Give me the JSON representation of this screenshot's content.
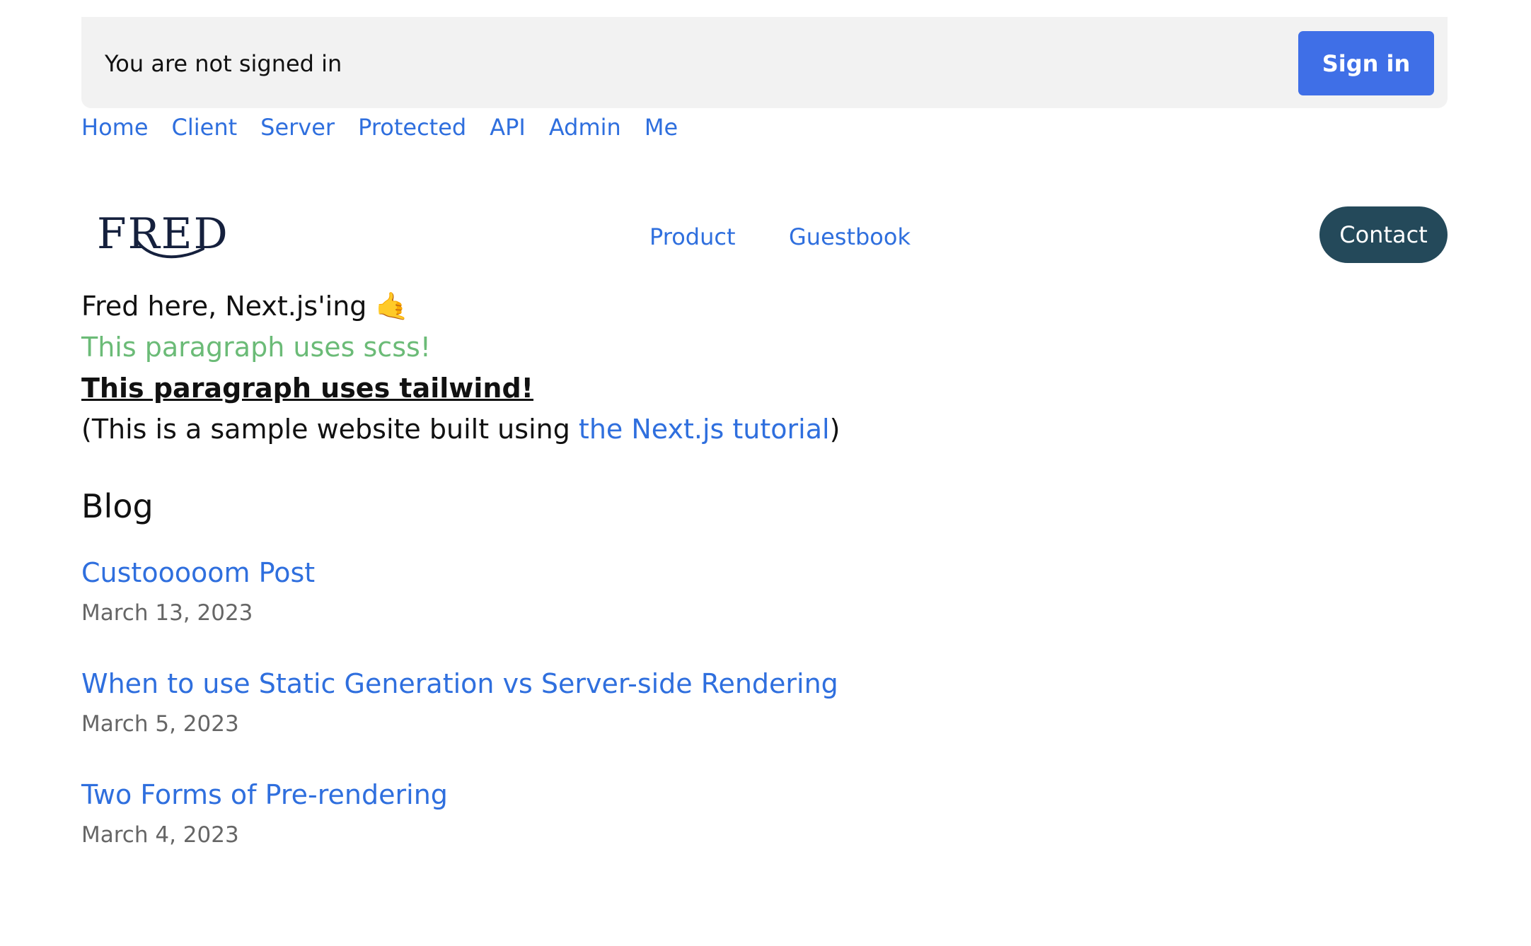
{
  "auth": {
    "status_text": "You are not signed in",
    "signin_label": "Sign in"
  },
  "top_nav": {
    "items": [
      {
        "label": "Home"
      },
      {
        "label": "Client"
      },
      {
        "label": "Server"
      },
      {
        "label": "Protected"
      },
      {
        "label": "API"
      },
      {
        "label": "Admin"
      },
      {
        "label": "Me"
      }
    ]
  },
  "header": {
    "logo_text": "FRED",
    "nav": {
      "product_label": "Product",
      "guestbook_label": "Guestbook"
    },
    "contact_label": "Contact"
  },
  "intro": {
    "greeting": "Fred here, Next.js'ing 🤙",
    "scss_line": "This paragraph uses scss!",
    "tailwind_line": "This paragraph uses tailwind!",
    "sample_prefix": "(This is a sample website built using ",
    "sample_link": "the Next.js tutorial",
    "sample_suffix": ")"
  },
  "blog": {
    "heading": "Blog",
    "posts": [
      {
        "title": "Custooooom Post",
        "date": "March 13, 2023"
      },
      {
        "title": "When to use Static Generation vs Server-side Rendering",
        "date": "March 5, 2023"
      },
      {
        "title": "Two Forms of Pre-rendering",
        "date": "March 4, 2023"
      }
    ]
  },
  "colors": {
    "link": "#2f6fde",
    "signin_button": "#3f6fe7",
    "contact_button": "#24495a",
    "scss_text": "#6bbb77",
    "auth_bar": "#f2f2f2",
    "date_text": "#666666"
  }
}
